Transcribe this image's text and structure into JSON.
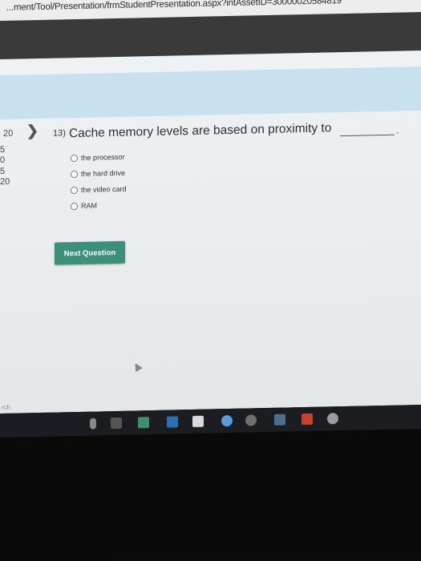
{
  "browser": {
    "url": "...ment/Tool/Presentation/frmStudentPresentation.aspx?intAssetID=30000020584819"
  },
  "left_nav": {
    "numbers": [
      "20",
      "5",
      "0",
      "5",
      "20"
    ]
  },
  "question": {
    "number": "13)",
    "text": "Cache memory levels are based on proximity to",
    "period": "."
  },
  "choices": [
    {
      "label": "the processor"
    },
    {
      "label": "the hard drive"
    },
    {
      "label": "the video card"
    },
    {
      "label": "RAM"
    }
  ],
  "next_button": {
    "label": "Next Question"
  },
  "taskbar": {
    "search_label": "rch",
    "icons": [
      "mic-icon",
      "task-view-icon",
      "app-icon",
      "store-icon",
      "shopping-bag-icon",
      "dropbox-icon",
      "infinity-icon",
      "media-icon",
      "powerpoint-icon",
      "settings-icon"
    ]
  },
  "colors": {
    "accent": "#3c8f7a",
    "banner": "#c9e1ef",
    "toolbar": "#3a3a3a",
    "taskbar": "#1c1d22"
  }
}
